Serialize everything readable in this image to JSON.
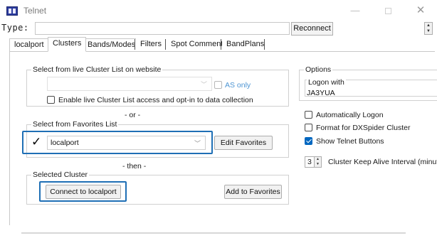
{
  "window": {
    "title": "Telnet",
    "minimize_glyph": "—",
    "close_glyph": "✕"
  },
  "type_row": {
    "label": "Type:",
    "input_value": "",
    "reconnect_label": "Reconnect"
  },
  "tabs": [
    {
      "label": "localport",
      "active": false
    },
    {
      "label": "Clusters",
      "active": true
    },
    {
      "label": "Bands/Modes",
      "active": false
    },
    {
      "label": "Filters",
      "active": false
    },
    {
      "label": "Spot Comment",
      "active": false
    },
    {
      "label": "BandPlans",
      "active": false
    }
  ],
  "live_list": {
    "group_title": "Select from live Cluster List on website",
    "combo_value": "",
    "as_only_label": "AS only",
    "as_only_checked": false,
    "enable_label": "Enable live Cluster List access and opt-in to data collection",
    "enable_checked": false
  },
  "separator_or": "- or -",
  "favorites": {
    "group_title": "Select from Favorites List",
    "check_glyph": "✓",
    "combo_value": "localport",
    "edit_favorites_label": "Edit Favorites"
  },
  "separator_then": "- then -",
  "selected": {
    "group_title": "Selected Cluster",
    "connect_label": "Connect to localport",
    "add_favorites_label": "Add to Favorites"
  },
  "options": {
    "group_title": "Options",
    "logon_title": "Logon with",
    "logon_value": "JA3YUA",
    "auto_logon_label": "Automatically Logon",
    "auto_logon_checked": false,
    "dxspider_label": "Format for DXSpider Cluster",
    "dxspider_checked": false,
    "show_buttons_label": "Show Telnet Buttons",
    "show_buttons_checked": true,
    "keepalive_value": "3",
    "keepalive_label": "Cluster Keep Alive Interval (minutes)"
  },
  "colors": {
    "accent": "#0067c0",
    "highlight_border": "#1f6fb5",
    "app_icon": "#2b3b9c"
  }
}
